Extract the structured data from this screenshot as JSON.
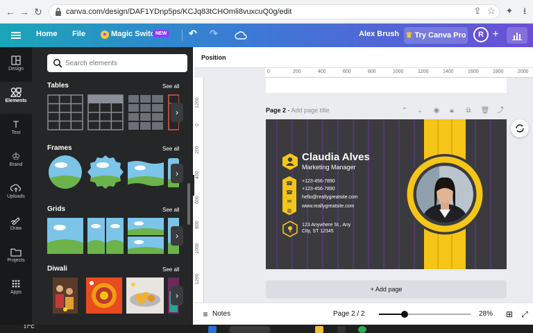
{
  "browser": {
    "url": "canva.com/design/DAF1YDnp5ps/KCJq83tCHOmli8vuxcuQ0g/edit"
  },
  "header": {
    "home": "Home",
    "file": "File",
    "magic_switch": "Magic Switch",
    "new_badge": "NEW",
    "font_name": "Alex Brush",
    "try_pro": "Try Canva Pro",
    "avatar_letter": "R"
  },
  "rail": {
    "items": [
      {
        "label": "Design",
        "icon": "layout-icon"
      },
      {
        "label": "Elements",
        "icon": "shapes-icon"
      },
      {
        "label": "Text",
        "icon": "text-icon"
      },
      {
        "label": "Brand",
        "icon": "crown-icon"
      },
      {
        "label": "Uploads",
        "icon": "upload-icon"
      },
      {
        "label": "Draw",
        "icon": "pen-icon"
      },
      {
        "label": "Projects",
        "icon": "folder-icon"
      },
      {
        "label": "Apps",
        "icon": "apps-icon"
      }
    ]
  },
  "panel": {
    "search_placeholder": "Search elements",
    "sections": [
      {
        "title": "Tables",
        "see_all": "See all"
      },
      {
        "title": "Frames",
        "see_all": "See all"
      },
      {
        "title": "Grids",
        "see_all": "See all"
      },
      {
        "title": "Diwali",
        "see_all": "See all"
      }
    ]
  },
  "canvas": {
    "toolbar_label": "Position",
    "ruler_top": [
      "0",
      "200",
      "400",
      "600",
      "800",
      "1000",
      "1200",
      "1400",
      "1600",
      "1800",
      "2000"
    ],
    "ruler_left": [
      "1200",
      "0",
      "200",
      "400",
      "600",
      "800",
      "1000",
      "1200"
    ],
    "page_label": "Page 2",
    "page_title_placeholder": "Add page title",
    "add_page": "+ Add page"
  },
  "card": {
    "name": "Claudia Alves",
    "role": "Marketing Manager",
    "phone1": "+123-456-7890",
    "phone2": "+123-456-7890",
    "email": "hello@reallygreatsite.com",
    "website": "www.reallygreatsite.com",
    "address_line1": "123 Anywhere St., Any",
    "address_line2": "City, ST 12345",
    "colors": {
      "background": "#3b3b3f",
      "accent": "#f5c518",
      "stripe": "#5a3a8a"
    }
  },
  "footer": {
    "notes": "Notes",
    "page_count": "Page 2 / 2",
    "zoom": "28%",
    "zoom_level": 0.28
  },
  "taskbar": {
    "weather": "17°C"
  }
}
